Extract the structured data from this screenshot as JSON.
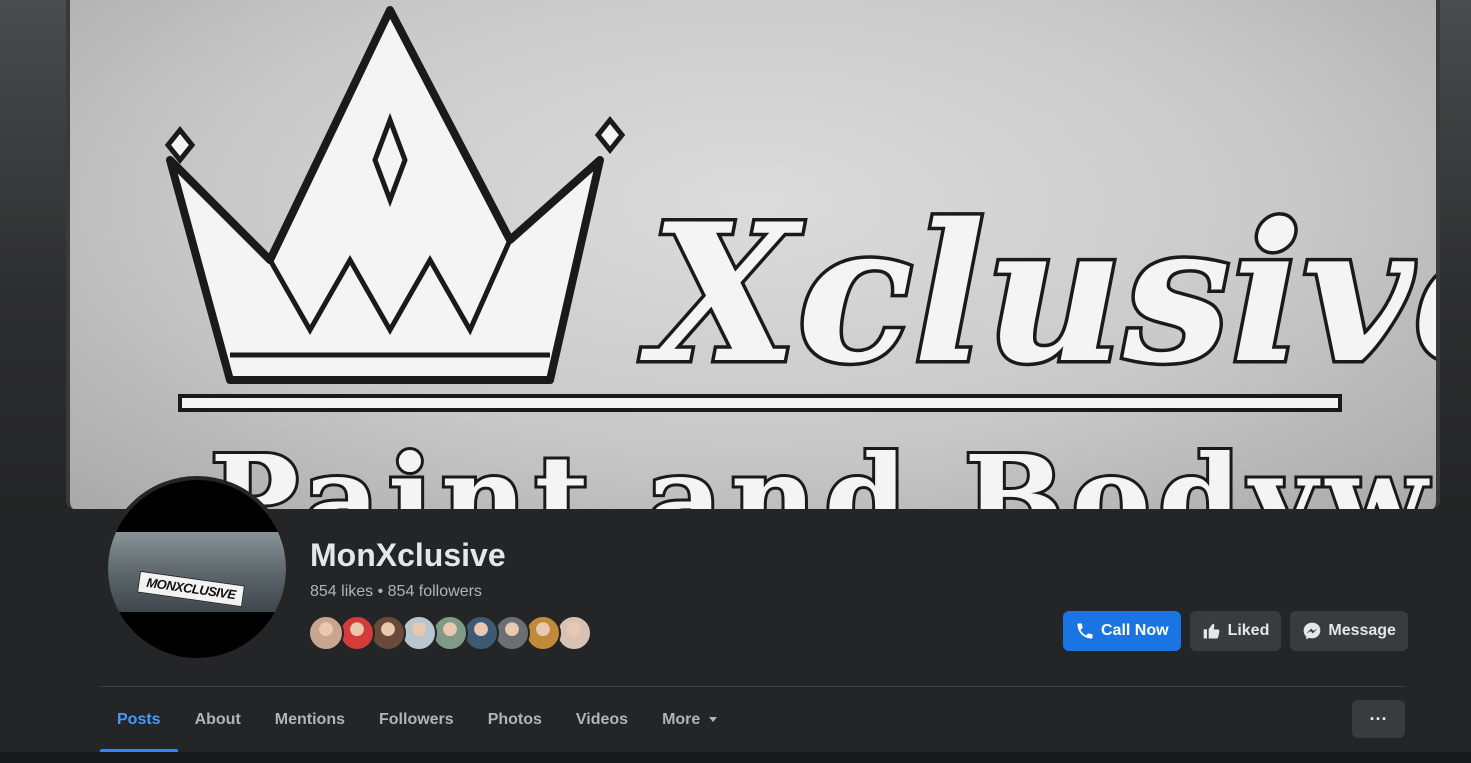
{
  "cover": {
    "title_text": "Xclusive",
    "subtitle_text": "Paint and Bodywork"
  },
  "avatar": {
    "plate_text": "MONXCLUSIVE"
  },
  "page": {
    "name": "MonXclusive",
    "stats": "854 likes • 854 followers"
  },
  "likers": {
    "colors": [
      "#c9a58f",
      "#d43b3b",
      "#6a4a3a",
      "#b9c6cf",
      "#7f9a86",
      "#3c5a73",
      "#6b6f73",
      "#c08a3a",
      "#d8c2b4"
    ]
  },
  "actions": {
    "call_label": "Call Now",
    "liked_label": "Liked",
    "message_label": "Message"
  },
  "tabs": {
    "items": [
      {
        "label": "Posts",
        "active": true
      },
      {
        "label": "About"
      },
      {
        "label": "Mentions"
      },
      {
        "label": "Followers"
      },
      {
        "label": "Photos"
      },
      {
        "label": "Videos"
      },
      {
        "label": "More"
      }
    ],
    "overflow_label": "···"
  }
}
